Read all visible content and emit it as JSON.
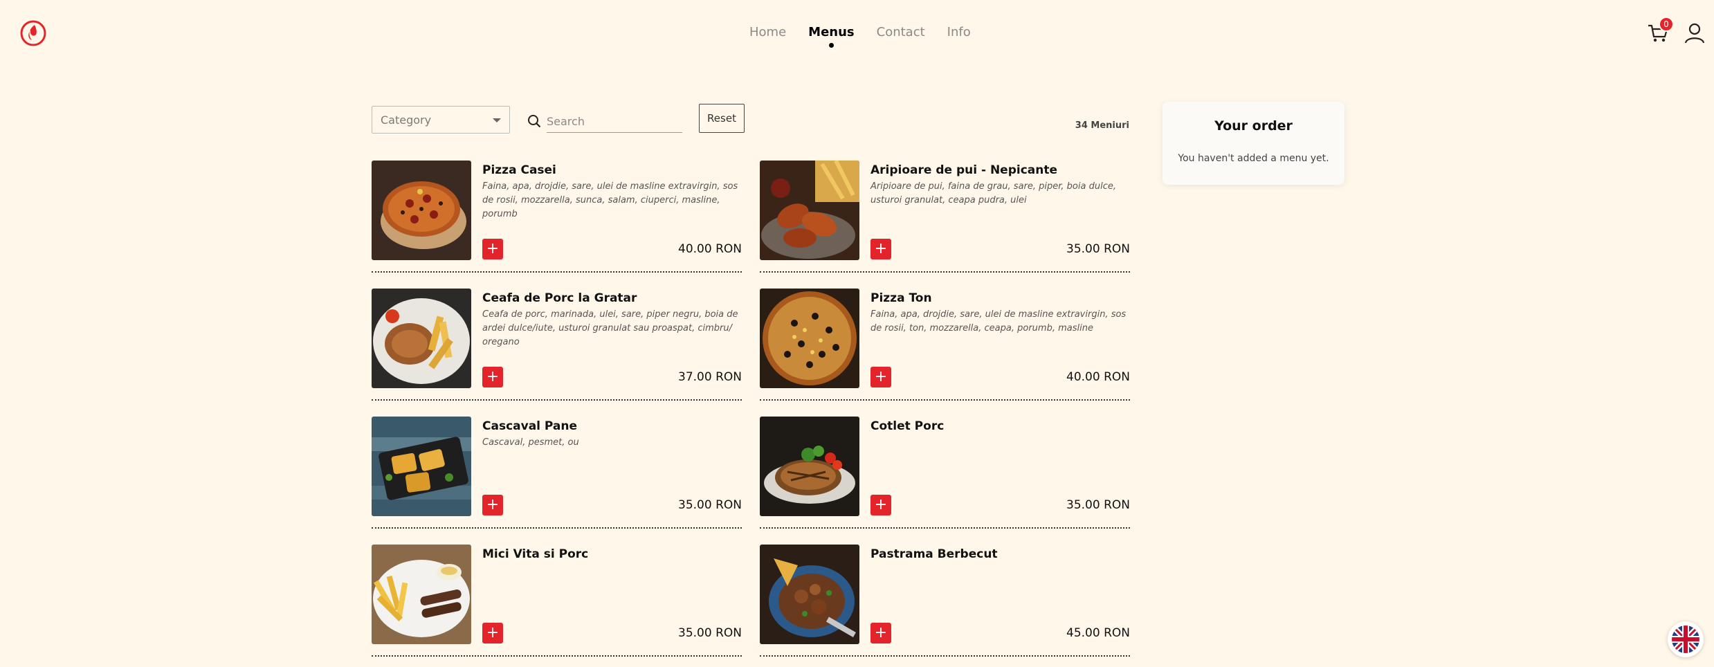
{
  "nav": {
    "items": [
      {
        "label": "Home",
        "active": false
      },
      {
        "label": "Menus",
        "active": true
      },
      {
        "label": "Contact",
        "active": false
      },
      {
        "label": "Info",
        "active": false
      }
    ]
  },
  "cart": {
    "count": "0",
    "icon": "cart-icon"
  },
  "filters": {
    "category_label": "Category",
    "search_placeholder": "Search",
    "reset_label": "Reset",
    "count_text": "34 Meniuri"
  },
  "order": {
    "title": "Your order",
    "empty_text": "You haven't added a menu yet."
  },
  "menus": [
    {
      "name": "Pizza Casei",
      "desc": "Faina, apa, drojdie, sare, ulei de masline extravirgin, sos de rosii, mozzarella, sunca, salam, ciuperci, masline, porumb",
      "price": "40.00 RON",
      "image": "pizza"
    },
    {
      "name": "Aripioare de pui - Nepicante",
      "desc": "Aripioare de pui, faina de grau, sare, piper, boia dulce, usturoi granulat, ceapa pudra, ulei",
      "price": "35.00 RON",
      "image": "wings"
    },
    {
      "name": "Ceafa de Porc la Gratar",
      "desc": "Ceafa de porc, marinada, ulei, sare, piper negru, boia de ardei dulce/iute, usturoi granulat sau proaspat, cimbru/ oregano",
      "price": "37.00 RON",
      "image": "pork-fries"
    },
    {
      "name": "Pizza Ton",
      "desc": "Faina, apa, drojdie, sare, ulei de masline extravirgin, sos de rosii, ton, mozzarella, ceapa, porumb, masline",
      "price": "40.00 RON",
      "image": "pizza-olives"
    },
    {
      "name": "Cascaval Pane",
      "desc": "Cascaval, pesmet, ou",
      "price": "35.00 RON",
      "image": "breaded-cheese"
    },
    {
      "name": "Cotlet Porc",
      "desc": "",
      "price": "35.00 RON",
      "image": "pork-chop"
    },
    {
      "name": "Mici Vita si Porc",
      "desc": "",
      "price": "35.00 RON",
      "image": "mici-fries"
    },
    {
      "name": "Pastrama Berbecut",
      "desc": "",
      "price": "45.00 RON",
      "image": "stew"
    }
  ],
  "colors": {
    "background": "#fff7e9",
    "accent": "#e3242b"
  },
  "language": {
    "icon": "uk-flag-icon"
  }
}
